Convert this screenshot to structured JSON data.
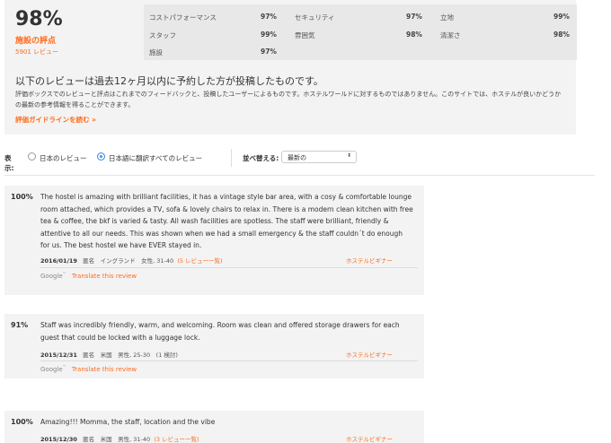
{
  "summary": {
    "score": "98%",
    "label": "施設の評点",
    "count": "5901 レビュー",
    "categories": [
      {
        "name": "コストパフォーマンス",
        "value": "97%"
      },
      {
        "name": "セキュリティ",
        "value": "97%"
      },
      {
        "name": "立地",
        "value": "99%"
      },
      {
        "name": "スタッフ",
        "value": "99%"
      },
      {
        "name": "雰囲気",
        "value": "98%"
      },
      {
        "name": "清潔さ",
        "value": "98%"
      },
      {
        "name": "施設",
        "value": "97%"
      }
    ],
    "info_title": "以下のレビューは過去12ヶ月以内に予約した方が投稿したものです。",
    "info_body": "評価ボックスでのレビューと評点はこれまでのフィードバックと、投稿したユーザーによるものです。ホステルワールドに対するものではありません。このサイトでは、ホステルが良いかどうかの最新の参考情報を得ることができます。",
    "info_link": "評価ガイドラインを読む »"
  },
  "filter": {
    "label": "表示:",
    "option1": "日本のレビュー",
    "option2": "日本語に翻訳すべてのレビュー",
    "sort_label": "並べ替える:",
    "sort_value": "最新の",
    "sort_arrow": "⬍"
  },
  "reviews": [
    {
      "score": "100%",
      "text": "The hostel is amazing with brilliant facilities, it has a vintage style bar area, with a cosy & comfortable lounge room attached, which provides a TV, sofa & lovely chairs to relax in. There is a modern clean kitchen with free tea & coffee, the bkf is varied & tasty. All wash facilities are spotless. The staff were brilliant, friendly & attentive to all our needs. This was shown when we had a small emergency & the staff couldn´t do enough for us. The best hostel we have EVER stayed in.",
      "date": "2016/01/19",
      "meta": "匿名　イングランド　女性, 31-40",
      "meta_link": "(5 レビュー一覧)",
      "badge": "ホステルビギナー",
      "google": "Google",
      "translate": "Translate this review"
    },
    {
      "score": "91%",
      "text": "Staff was incredibly friendly, warm, and welcoming. Room was clean and offered storage drawers for each guest that could be locked with a luggage lock.",
      "date": "2015/12/31",
      "meta": "匿名　米国　男性, 25-30　(1 検討)",
      "meta_link": "",
      "badge": "ホステルビギナー",
      "google": "Google",
      "translate": "Translate this review"
    },
    {
      "score": "100%",
      "text": "Amazing!!! Momma, the staff, location and the vibe",
      "date": "2015/12/30",
      "meta": "匿名　米国　男性, 31-40",
      "meta_link": "(3 レビュー一覧)",
      "badge": "ホステルビギナー"
    }
  ]
}
